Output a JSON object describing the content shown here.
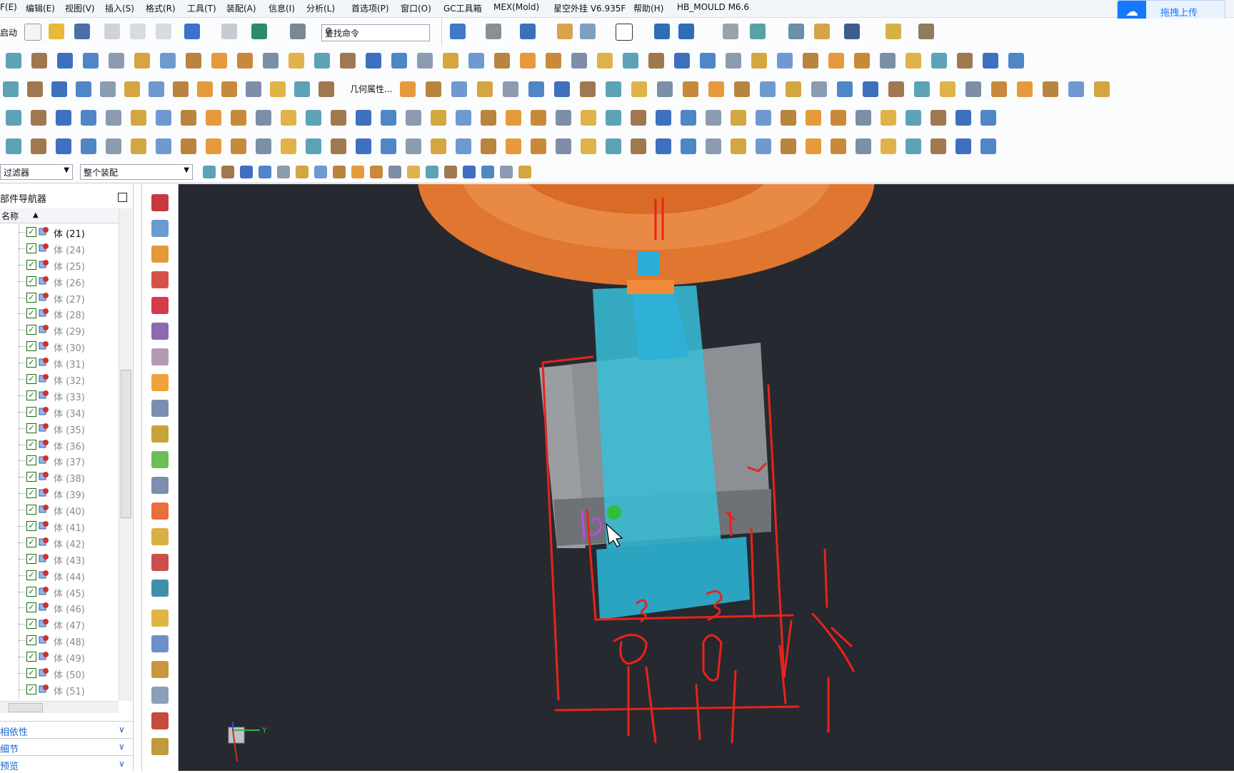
{
  "menubar": {
    "items": [
      "F(E)",
      "编辑(E)",
      "视图(V)",
      "插入(S)",
      "格式(R)",
      "工具(T)",
      "装配(A)",
      "信息(I)",
      "分析(L)",
      "首选项(P)",
      "窗口(O)",
      "GC工具箱",
      "MEX(Mold)",
      "星空外挂 V6.935F",
      "帮助(H)",
      "HB_MOULD M6.6"
    ]
  },
  "upload": {
    "label": "拖拽上传",
    "icon": "cloud-icon"
  },
  "toolbar": {
    "start_label": "启动",
    "search_placeholder": "查找命令",
    "geometry_props_label": "几何属性...",
    "filter_label": "过滤器",
    "scope_label": "整个装配"
  },
  "navigator": {
    "title": "部件导航器",
    "column_name": "名称",
    "items": [
      "体 (21)",
      "体 (24)",
      "体 (25)",
      "体 (26)",
      "体 (27)",
      "体 (28)",
      "体 (29)",
      "体 (30)",
      "体 (31)",
      "体 (32)",
      "体 (33)",
      "体 (34)",
      "体 (35)",
      "体 (36)",
      "体 (37)",
      "体 (38)",
      "体 (39)",
      "体 (40)",
      "体 (41)",
      "体 (42)",
      "体 (43)",
      "体 (44)",
      "体 (45)",
      "体 (46)",
      "体 (47)",
      "体 (48)",
      "体 (49)",
      "体 (50)",
      "体 (51)"
    ],
    "sections": [
      "相依性",
      "细节",
      "预览"
    ]
  },
  "viewport": {
    "background": "#272930",
    "triad_y_label": "Y",
    "annotation_color": "#e8231c"
  }
}
